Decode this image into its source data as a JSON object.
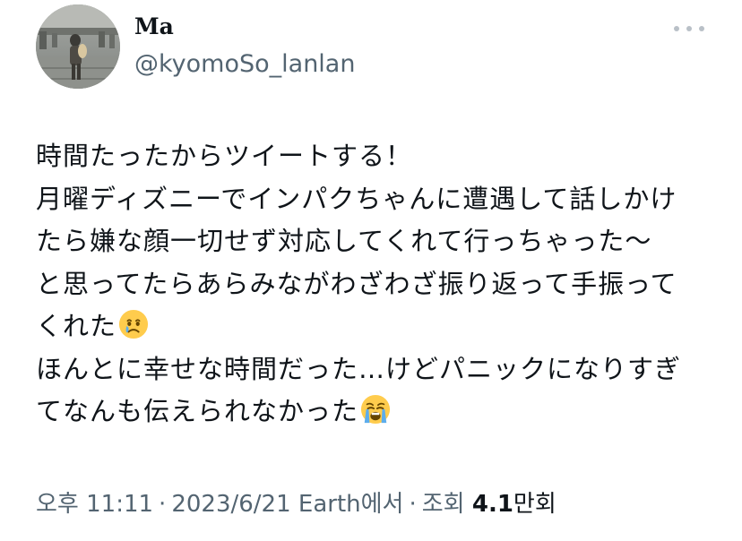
{
  "author": {
    "display_name": "Ma",
    "handle": "@kyomoSo_lanlan",
    "avatar_icon": "photo-avatar"
  },
  "tweet": {
    "lines": [
      "時間たったからツイートする！",
      "月曜ディズニーでインパクちゃんに遭遇して話しかけ",
      "たら嫌な顔一切せず対応してくれて行っちゃった～",
      "と思ってたらあらみながわざわざ振り返って手振って",
      "くれた",
      "ほんとに幸せな時間だった…けどパニックになりすぎ",
      "てなんも伝えられなかった"
    ],
    "emoji_1": "face-holding-back-tears-icon",
    "emoji_2": "loudly-crying-face-icon"
  },
  "meta": {
    "time": "오후 11:11",
    "separator": "·",
    "date": "2023/6/21",
    "source": "Earth에서",
    "views_label": "조회",
    "views_count": "4.1",
    "views_unit": "만회"
  },
  "colors": {
    "text_primary": "#0f1419",
    "text_secondary": "#536471",
    "more_dots": "#b9c0c7"
  }
}
